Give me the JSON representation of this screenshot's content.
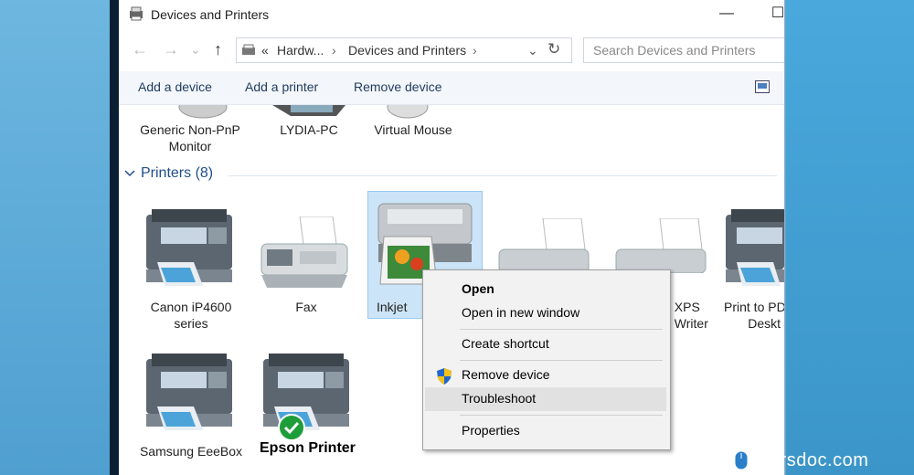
{
  "window": {
    "title": "Devices and Printers",
    "controls": {
      "minimize": "—",
      "maximize": "☐"
    }
  },
  "nav": {
    "back": "←",
    "forward": "→",
    "history": "⌄",
    "up": "↑",
    "address": {
      "overflow": "«",
      "crumbs": [
        "Hardw...",
        "Devices and Printers"
      ],
      "separator": "›",
      "refresh": "↻",
      "dropdown": "⌄"
    },
    "search_placeholder": "Search Devices and Printers"
  },
  "commands": {
    "add_device": "Add a device",
    "add_printer": "Add a printer",
    "remove_device": "Remove device"
  },
  "devices": [
    {
      "label_line1": "Generic Non-PnP",
      "label_line2": "Monitor"
    },
    {
      "label_line1": "LYDIA-PC",
      "label_line2": ""
    },
    {
      "label_line1": "Virtual Mouse",
      "label_line2": ""
    }
  ],
  "printers_section": {
    "header": "Printers (8)",
    "toggle_icon": "chevron-down-icon"
  },
  "printers": [
    {
      "label_line1": "Canon iP4600",
      "label_line2": "series"
    },
    {
      "label_line1": "Fax",
      "label_line2": ""
    },
    {
      "label_line1": "Inkjet",
      "label_line2": ""
    },
    {
      "label_line1": "",
      "label_line2": ""
    },
    {
      "label_line1": "t XPS",
      "label_line2": "t Writer"
    },
    {
      "label_line1": "Print to PD",
      "label_line2": "Deskt"
    },
    {
      "label_line1": "Samsung EeeBox",
      "label_line2": ""
    },
    {
      "label_line1": "",
      "label_line2": ""
    }
  ],
  "context_menu": {
    "open": "Open",
    "open_new_window": "Open in new window",
    "create_shortcut": "Create shortcut",
    "remove_device": "Remove device",
    "troubleshoot": "Troubleshoot",
    "properties": "Properties"
  },
  "epson_label": "Epson Printer",
  "watermark": "orsdoc.com",
  "colors": {
    "accent": "#1f4e8c",
    "selection": "#cce4f7",
    "check": "#1e9e3a",
    "shield_blue": "#2266cc",
    "shield_yellow": "#f3c219"
  }
}
